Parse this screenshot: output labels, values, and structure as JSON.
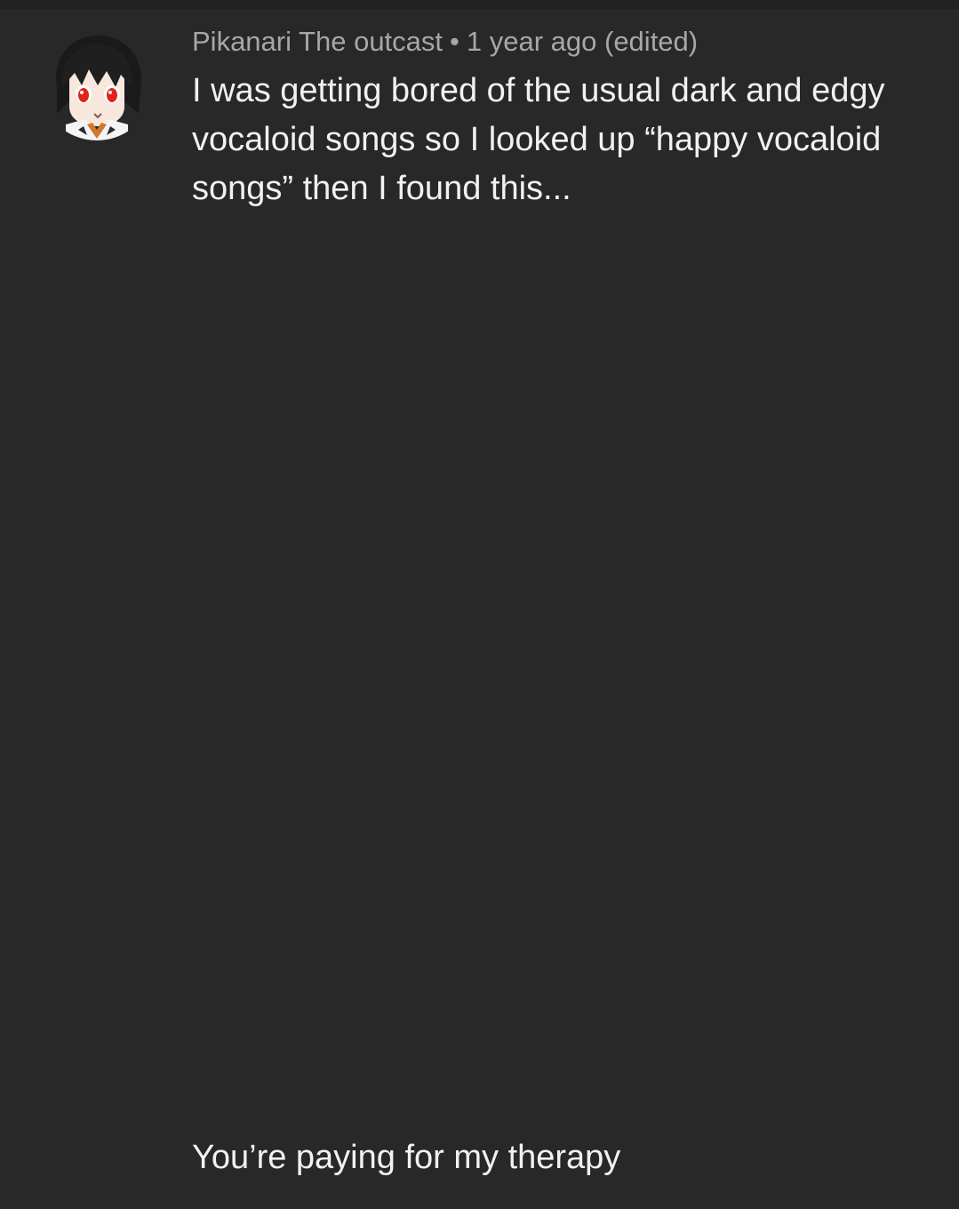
{
  "comment": {
    "avatar_icon": "anime-avatar-icon",
    "author": "Pikanari The outcast",
    "separator": "•",
    "timestamp": "1 year ago (edited)",
    "body_paragraph_1": "I was getting bored of the usual dark and edgy vocaloid songs so I looked up “happy vocaloid songs” then I found this...",
    "body_paragraph_2": "You’re paying for my therapy"
  },
  "colors": {
    "background": "#282828",
    "meta_text": "#a7a7a7",
    "body_text": "#f1f1f1",
    "avatar_eye": "#e0241b"
  }
}
